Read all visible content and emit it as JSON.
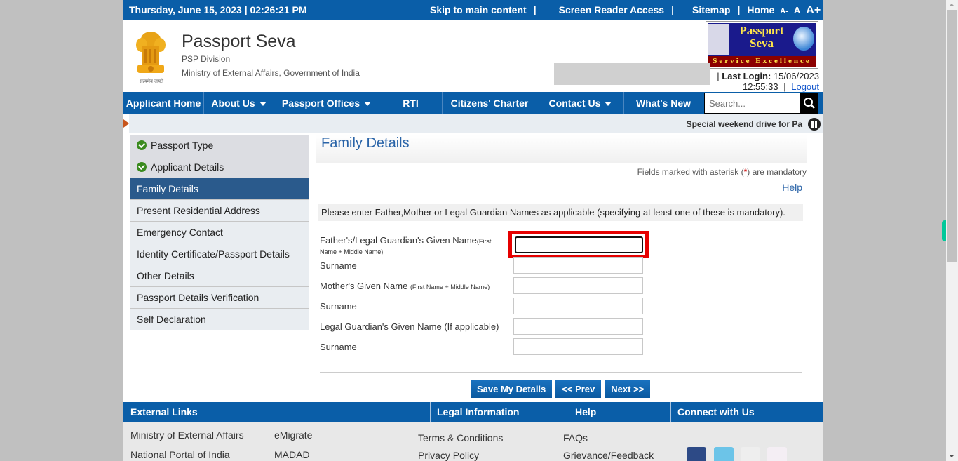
{
  "topbar": {
    "datetime": "Thursday,  June  15, 2023 | 02:26:21 PM",
    "skip": "Skip to main content",
    "screen_reader": "Screen Reader Access",
    "sitemap": "Sitemap",
    "home": "Home",
    "sep": "|",
    "font_small": "A-",
    "font_normal": "A",
    "font_large": "A+"
  },
  "header": {
    "title": "Passport Seva",
    "division": "PSP Division",
    "ministry": "Ministry of External Affairs, Government of India",
    "emblem_motto": "सत्यमेव जयते",
    "logo_line1": "Passport",
    "logo_line2": "Seva",
    "logo_band": "Service Excellence",
    "last_login_label": "Last Login:",
    "last_login_date": "15/06/2023",
    "last_login_time": "12:55:33",
    "logout": "Logout",
    "sep": "|"
  },
  "nav": {
    "items": [
      {
        "label": "Applicant Home",
        "dropdown": false
      },
      {
        "label": "About Us",
        "dropdown": true
      },
      {
        "label": "Passport Offices",
        "dropdown": true
      },
      {
        "label": "RTI",
        "dropdown": false
      },
      {
        "label": "Citizens' Charter",
        "dropdown": false
      },
      {
        "label": "Contact Us",
        "dropdown": true
      },
      {
        "label": "What's New",
        "dropdown": false
      }
    ],
    "search_placeholder": "Search..."
  },
  "ticker": {
    "text": "Special weekend drive for Pa"
  },
  "sidebar": {
    "items": [
      {
        "label": "Passport Type",
        "state": "done"
      },
      {
        "label": "Applicant Details",
        "state": "done"
      },
      {
        "label": "Family Details",
        "state": "active"
      },
      {
        "label": "Present Residential Address",
        "state": "pending"
      },
      {
        "label": "Emergency Contact",
        "state": "pending"
      },
      {
        "label": "Identity Certificate/Passport Details",
        "state": "pending"
      },
      {
        "label": "Other Details",
        "state": "pending"
      },
      {
        "label": "Passport Details Verification",
        "state": "pending"
      },
      {
        "label": "Self Declaration",
        "state": "pending"
      }
    ]
  },
  "main": {
    "title": "Family Details",
    "mandatory_prefix": "Fields marked with asterisk (",
    "mandatory_asterisk": "*",
    "mandatory_suffix": ") are mandatory",
    "help": "Help",
    "instruction": "Please enter Father,Mother or Legal Guardian Names as applicable (specifying at least one of these is mandatory).",
    "fields": [
      {
        "label": "Father's/Legal Guardian's Given Name",
        "hint": "(First Name + Middle Name)",
        "value": ""
      },
      {
        "label": "Surname",
        "hint": "",
        "value": ""
      },
      {
        "label": "Mother's Given Name",
        "hint": "(First Name + Middle Name)",
        "value": ""
      },
      {
        "label": "Surname",
        "hint": "",
        "value": ""
      },
      {
        "label": "Legal Guardian's Given Name (If applicable)",
        "hint": "",
        "value": ""
      },
      {
        "label": "Surname",
        "hint": "",
        "value": ""
      }
    ],
    "buttons": {
      "save": "Save My Details",
      "prev": "<< Prev",
      "next": "Next >>"
    }
  },
  "footer": {
    "headers": [
      "External Links",
      "Legal Information",
      "Help",
      "Connect with Us"
    ],
    "external_links": [
      "Ministry of External Affairs",
      "National Portal of India",
      "eMigrate",
      "MADAD"
    ],
    "legal_links": [
      "Terms & Conditions",
      "Privacy Policy"
    ],
    "help_links": [
      "FAQs",
      "Grievance/Feedback"
    ],
    "social": [
      "facebook",
      "twitter",
      "youtube",
      "flickr"
    ]
  },
  "colors": {
    "primary_blue": "#0a5ea8",
    "active_sidebar": "#2a5a8c",
    "focus_highlight": "#e60000",
    "ticker_arrow": "#c8541a"
  }
}
